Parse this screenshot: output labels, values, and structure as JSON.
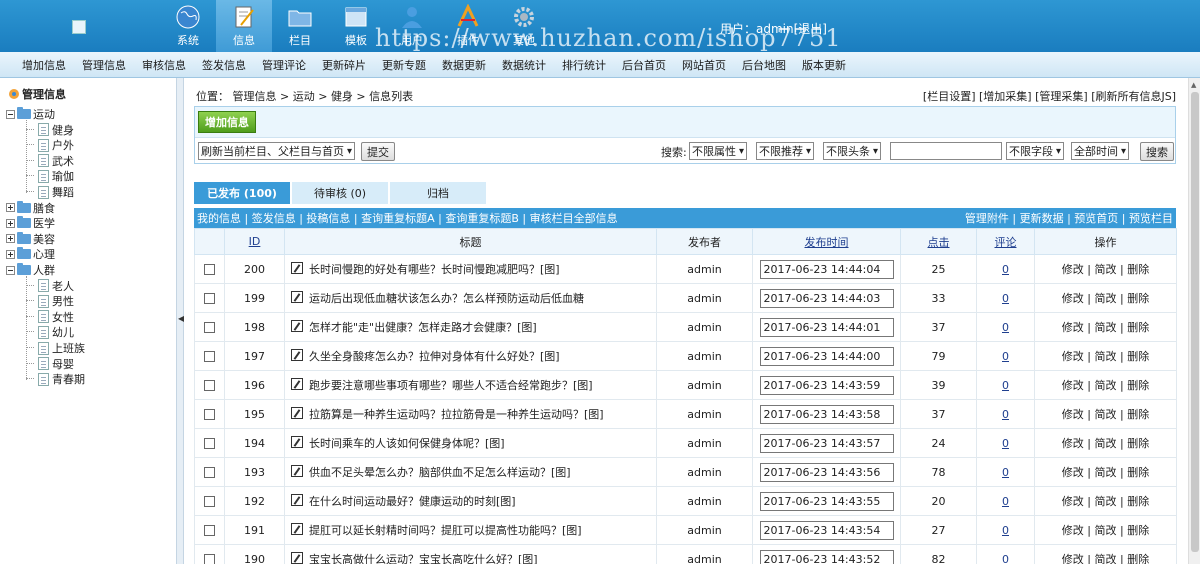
{
  "header": {
    "nav": [
      {
        "label": "系统",
        "icon": "globe-icon"
      },
      {
        "label": "信息",
        "icon": "document-edit-icon"
      },
      {
        "label": "栏目",
        "icon": "folder-icon"
      },
      {
        "label": "模板",
        "icon": "window-icon"
      },
      {
        "label": "用户",
        "icon": "user-icon"
      },
      {
        "label": "插件",
        "icon": "tools-icon"
      },
      {
        "label": "其他",
        "icon": "gear-icon"
      }
    ],
    "user_label": "用户：",
    "username": "admin",
    "logout": "[退出]",
    "watermark": "https://www.huzhan.com/ishop7751"
  },
  "subnav": [
    "增加信息",
    "管理信息",
    "审核信息",
    "签发信息",
    "管理评论",
    "更新碎片",
    "更新专题",
    "数据更新",
    "数据统计",
    "排行统计",
    "后台首页",
    "网站首页",
    "后台地图",
    "版本更新"
  ],
  "tree": {
    "title": "管理信息",
    "nodes": [
      {
        "label": "运动",
        "children": [
          "健身",
          "户外",
          "武术",
          "瑜伽",
          "舞蹈"
        ]
      },
      {
        "label": "膳食",
        "children": []
      },
      {
        "label": "医学",
        "children": []
      },
      {
        "label": "美容",
        "children": []
      },
      {
        "label": "心理",
        "children": []
      },
      {
        "label": "人群",
        "children": [
          "老人",
          "男性",
          "女性",
          "幼儿",
          "上班族",
          "母婴",
          "青春期"
        ]
      }
    ]
  },
  "main": {
    "crumb_prefix": "位置：",
    "crumb": [
      "管理信息",
      "运动",
      "健身",
      "信息列表"
    ],
    "top_links": [
      "[栏目设置]",
      "[增加采集]",
      "[管理采集]",
      "[刷新所有信息JS]"
    ],
    "add_button": "增加信息",
    "refresh_select": "刷新当前栏目、父栏目与首页",
    "submit_button": "提交",
    "search_label": "搜索:",
    "filters": [
      "不限属性",
      "不限推荐",
      "不限头条"
    ],
    "search_value": "",
    "field_select": "不限字段",
    "time_select": "全部时间",
    "search_button": "搜索",
    "tabs": [
      "已发布 (100)",
      "待审核 (0)",
      "归档"
    ],
    "list_links_left": [
      "我的信息",
      "签发信息",
      "投稿信息",
      "查询重复标题A",
      "查询重复标题B",
      "审核栏目全部信息"
    ],
    "list_links_right": [
      "管理附件",
      "更新数据",
      "预览首页",
      "预览栏目"
    ],
    "columns": [
      "ID",
      "标题",
      "发布者",
      "发布时间",
      "点击",
      "评论",
      "操作"
    ],
    "ops": [
      "修改",
      "简改",
      "删除"
    ],
    "rows": [
      {
        "id": "200",
        "title": "长时间慢跑的好处有哪些？长时间慢跑减肥吗？[图]",
        "author": "admin",
        "time": "2017-06-23 14:44:04",
        "clicks": "25",
        "comments": "0"
      },
      {
        "id": "199",
        "title": "运动后出现低血糖状该怎么办？怎么样预防运动后低血糖",
        "author": "admin",
        "time": "2017-06-23 14:44:03",
        "clicks": "33",
        "comments": "0"
      },
      {
        "id": "198",
        "title": "怎样才能\"走\"出健康？怎样走路才会健康？[图]",
        "author": "admin",
        "time": "2017-06-23 14:44:01",
        "clicks": "37",
        "comments": "0"
      },
      {
        "id": "197",
        "title": "久坐全身酸疼怎么办？拉伸对身体有什么好处？[图]",
        "author": "admin",
        "time": "2017-06-23 14:44:00",
        "clicks": "79",
        "comments": "0"
      },
      {
        "id": "196",
        "title": "跑步要注意哪些事项有哪些？哪些人不适合经常跑步？[图]",
        "author": "admin",
        "time": "2017-06-23 14:43:59",
        "clicks": "39",
        "comments": "0"
      },
      {
        "id": "195",
        "title": "拉筋算是一种养生运动吗？拉拉筋骨是一种养生运动吗？[图]",
        "author": "admin",
        "time": "2017-06-23 14:43:58",
        "clicks": "37",
        "comments": "0"
      },
      {
        "id": "194",
        "title": "长时间乘车的人该如何保健身体呢？[图]",
        "author": "admin",
        "time": "2017-06-23 14:43:57",
        "clicks": "24",
        "comments": "0"
      },
      {
        "id": "193",
        "title": "供血不足头晕怎么办？脑部供血不足怎么样运动？[图]",
        "author": "admin",
        "time": "2017-06-23 14:43:56",
        "clicks": "78",
        "comments": "0"
      },
      {
        "id": "192",
        "title": "在什么时间运动最好？健康运动的时刻[图]",
        "author": "admin",
        "time": "2017-06-23 14:43:55",
        "clicks": "20",
        "comments": "0"
      },
      {
        "id": "191",
        "title": "提肛可以延长射精时间吗？提肛可以提高性功能吗？[图]",
        "author": "admin",
        "time": "2017-06-23 14:43:54",
        "clicks": "27",
        "comments": "0"
      },
      {
        "id": "190",
        "title": "宝宝长高做什么运动？宝宝长高吃什么好？[图]",
        "author": "admin",
        "time": "2017-06-23 14:43:52",
        "clicks": "82",
        "comments": "0"
      }
    ]
  }
}
